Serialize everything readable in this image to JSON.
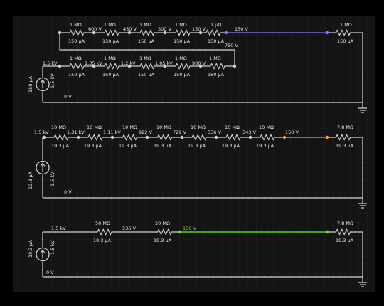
{
  "colors": {
    "background": "#000000",
    "panel": "#141414",
    "grid": "#262626",
    "wire": "#d0d0d0",
    "dot": "#bdbdbd",
    "blue": "#7d7dff",
    "orange": "#ff9a33",
    "green": "#66ee22",
    "text": "#e6e6e6"
  },
  "circuit1": {
    "source_current": "150 µA",
    "source_voltage": "1.5 kV",
    "ground_voltage": "0 V",
    "top_row": {
      "resistors": [
        "1 MΩ",
        "1 MΩ",
        "1 MΩ",
        "1 MΩ",
        "1 µΩ",
        "1 MΩ"
      ],
      "currents": [
        "150 µA",
        "150 µA",
        "150 µA",
        "150 µA",
        "150 µA",
        "150 µA"
      ],
      "node_voltages": [
        "600 V",
        "450 V",
        "300 V",
        "150 V",
        "150 V"
      ]
    },
    "mid_row": {
      "resistors": [
        "1 MΩ",
        "1 MΩ",
        "1 MΩ",
        "1 MΩ",
        "1 MΩ"
      ],
      "currents": [
        "150 µA",
        "150 µA",
        "150 µA",
        "150 µA",
        "150 µA"
      ],
      "node_voltages": [
        "1.5 kV",
        "1.35 kV",
        "1.2 kV",
        "1.05 kV",
        "900 V"
      ],
      "return_voltage": "750 V"
    }
  },
  "circuit2": {
    "source_current": "19.3 µA",
    "source_voltage": "1.5 kV",
    "ground_voltage": "0 V",
    "resistors": [
      "10 MΩ",
      "10 MΩ",
      "10 MΩ",
      "10 MΩ",
      "10 MΩ",
      "10 MΩ",
      "10 MΩ",
      "7.8 MΩ"
    ],
    "currents": [
      "19.3 µA",
      "19.3 µA",
      "19.3 µA",
      "19.3 µA",
      "19.3 µA",
      "19.3 µA",
      "19.3 µA",
      "19.3 µA"
    ],
    "node_voltages": [
      "1.5 kV",
      "1.31 kV",
      "1.11 kV",
      "922 V",
      "729 V",
      "536 V",
      "343 V",
      "150 V"
    ]
  },
  "circuit3": {
    "source_current": "19.3 µA",
    "source_voltage": "1.5 kV",
    "ground_voltage": "0 V",
    "resistors": [
      "50 MΩ",
      "20 MΩ",
      "7.8 MΩ"
    ],
    "currents": [
      "19.3 µA",
      "19.3 µA",
      "19.3 µA"
    ],
    "node_voltages": [
      "1.5 kV",
      "536 V",
      "150 V"
    ]
  }
}
